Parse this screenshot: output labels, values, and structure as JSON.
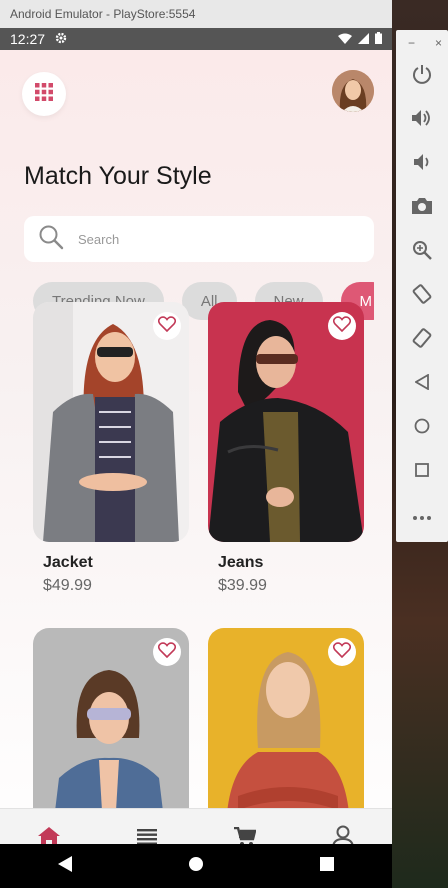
{
  "window": {
    "title": "Android Emulator - PlayStore:5554"
  },
  "status_bar": {
    "time": "12:27"
  },
  "app": {
    "title": "Match Your Style",
    "search": {
      "placeholder": "Search"
    },
    "categories": [
      {
        "label": "Trending Now",
        "active": false
      },
      {
        "label": "All",
        "active": false
      },
      {
        "label": "New",
        "active": false
      },
      {
        "label": "M",
        "active": true
      }
    ],
    "products": [
      {
        "name": "Jacket",
        "price": "$49.99",
        "photo_bg": "#f1efef"
      },
      {
        "name": "Jeans",
        "price": "$39.99",
        "photo_bg": "#c8334f"
      },
      {
        "name": "",
        "price": "",
        "photo_bg": "#b9b9b9"
      },
      {
        "name": "",
        "price": "",
        "photo_bg": "#e8b22a"
      }
    ],
    "bottom_nav": [
      {
        "icon": "home-icon",
        "active": true
      },
      {
        "icon": "list-icon",
        "active": false
      },
      {
        "icon": "cart-icon",
        "active": false
      },
      {
        "icon": "profile-icon",
        "active": false
      }
    ]
  },
  "emulator_toolbar": [
    "power-icon",
    "volume-up-icon",
    "volume-down-icon",
    "camera-icon",
    "zoom-icon",
    "rotate-left-icon",
    "rotate-right-icon",
    "back-icon",
    "home-circle-icon",
    "overview-icon",
    "more-icon"
  ],
  "colors": {
    "accent": "#de5875",
    "accent_dark": "#c23a58",
    "chip_inactive": "#dcdcdc"
  }
}
